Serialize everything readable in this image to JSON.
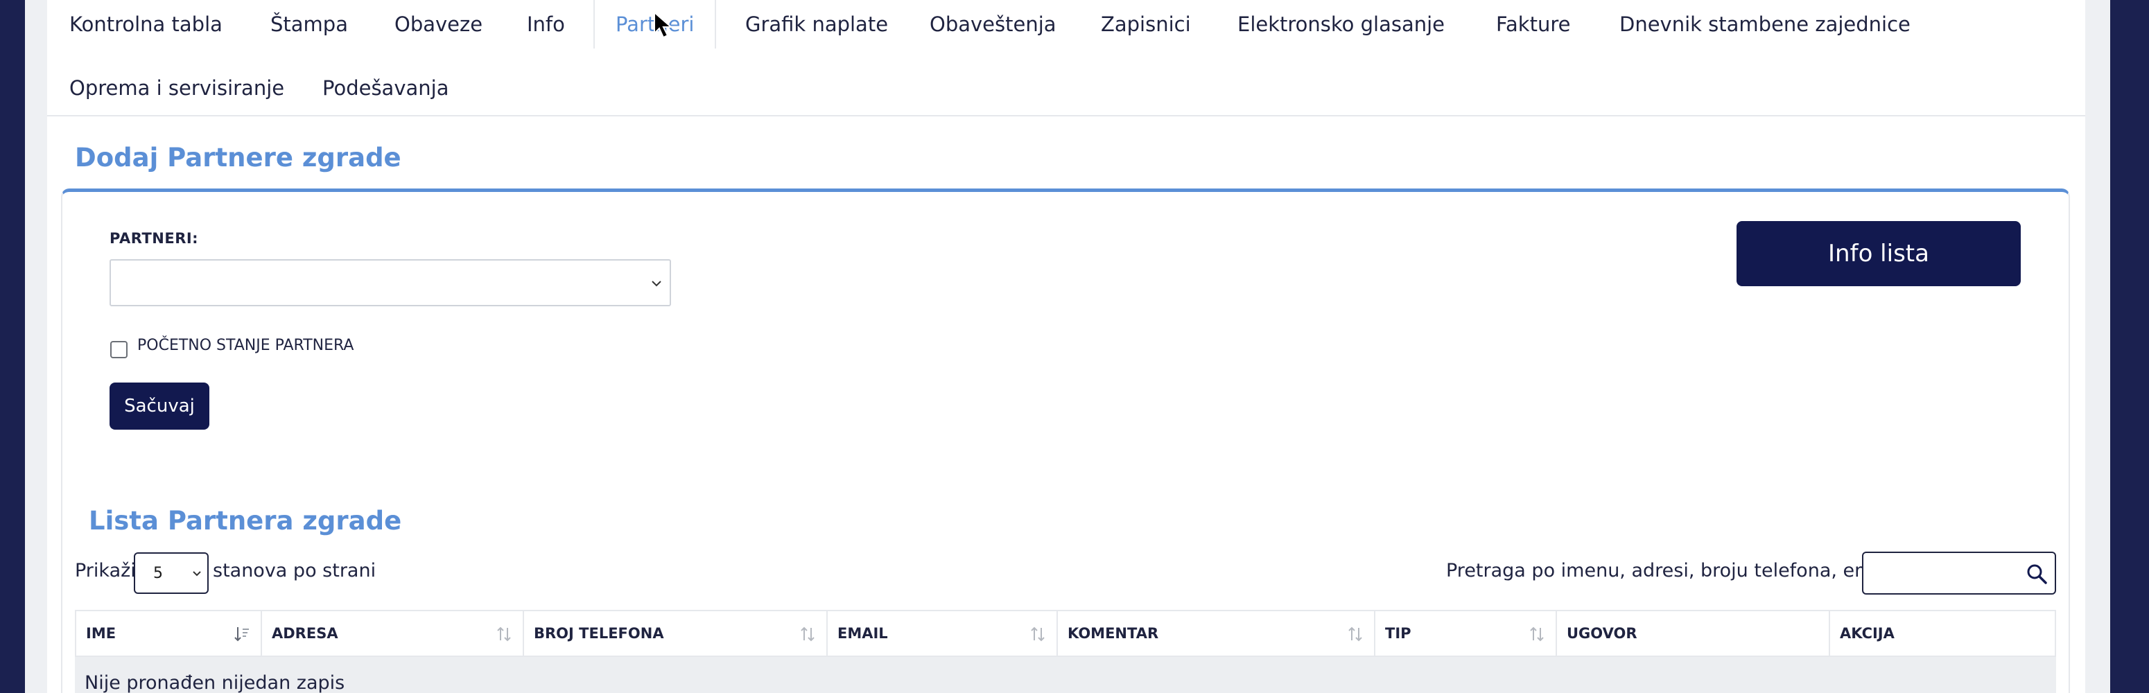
{
  "nav": {
    "items": [
      {
        "label": "Kontrolna tabla"
      },
      {
        "label": "Štampa"
      },
      {
        "label": "Obaveze"
      },
      {
        "label": "Info"
      },
      {
        "label": "Partneri"
      },
      {
        "label": "Grafik naplate"
      },
      {
        "label": "Obaveštenja"
      },
      {
        "label": "Zapisnici"
      },
      {
        "label": "Elektronsko glasanje"
      },
      {
        "label": "Fakture"
      },
      {
        "label": "Dnevnik stambene zajednice"
      },
      {
        "label": "Oprema i servisiranje"
      },
      {
        "label": "Podešavanja"
      }
    ],
    "active_index": 4
  },
  "add_section": {
    "title": "Dodaj Partnere zgrade",
    "partners_label": "PARTNERI:",
    "partners_value": "",
    "initial_state_label": "POČETNO STANJE PARTNERA",
    "initial_state_checked": false,
    "save_label": "Sačuvaj",
    "info_button_label": "Info lista"
  },
  "list_section": {
    "title": "Lista Partnera zgrade",
    "show_label": "Prikaži",
    "per_page_value": "5",
    "per_page_suffix": "stanova po strani",
    "search_label": "Pretraga po imenu, adresi, broju telefona, emailu...",
    "search_value": "",
    "columns": [
      {
        "label": "IME",
        "sort": "active-desc"
      },
      {
        "label": "ADRESA",
        "sort": "both"
      },
      {
        "label": "BROJ TELEFONA",
        "sort": "both"
      },
      {
        "label": "EMAIL",
        "sort": "both"
      },
      {
        "label": "KOMENTAR",
        "sort": "both"
      },
      {
        "label": "TIP",
        "sort": "both"
      },
      {
        "label": "UGOVOR",
        "sort": "none"
      },
      {
        "label": "AKCIJA",
        "sort": "none"
      }
    ],
    "empty_text": "Nije pronađen nijedan zapis"
  },
  "icons": {
    "select_chevron": "chevron-down-icon",
    "search": "search-icon",
    "sort": "sort-icon",
    "cursor": "mouse-pointer-icon"
  },
  "colors": {
    "frame": "#1b2150",
    "accent": "#5b8fd6",
    "button": "#12194f",
    "text": "#1f2340",
    "empty_row": "#eceef1"
  }
}
